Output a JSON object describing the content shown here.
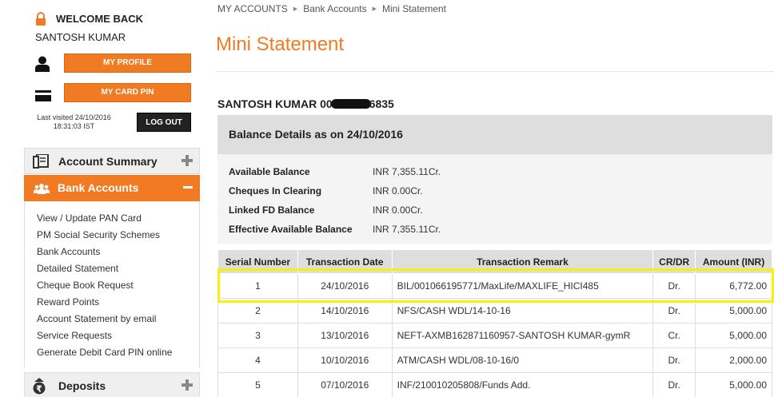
{
  "sidebar": {
    "welcome_title": "WELCOME BACK",
    "user_name": "SANTOSH KUMAR",
    "my_profile_label": "MY PROFILE",
    "my_card_pin_label": "MY CARD PIN",
    "last_visited_line1": "Last visited 24/10/2016",
    "last_visited_line2": "18:31:03 IST",
    "logout_label": "LOG OUT",
    "account_summary_label": "Account Summary",
    "bank_accounts_label": "Bank Accounts",
    "bank_accounts_items": [
      "View / Update PAN Card",
      "PM Social Security Schemes",
      "Bank Accounts",
      "Detailed Statement",
      "Cheque Book Request",
      "Reward Points",
      "Account Statement by email",
      "Service Requests",
      "Generate Debit Card PIN online"
    ],
    "deposits_label": "Deposits",
    "accent_color": "#f07b23"
  },
  "breadcrumb": [
    "MY ACCOUNTS",
    "Bank Accounts",
    "Mini Statement"
  ],
  "page_title": "Mini Statement",
  "account": {
    "name_prefix": "SANTOSH KUMAR 00",
    "name_suffix": "6835"
  },
  "balance": {
    "header": "Balance Details as on 24/10/2016",
    "rows": [
      {
        "label": "Available Balance",
        "value": "INR 7,355.11Cr."
      },
      {
        "label": "Cheques In Clearing",
        "value": "INR 0.00Cr."
      },
      {
        "label": "Linked FD Balance",
        "value": "INR 0.00Cr."
      },
      {
        "label": "Effective Available Balance",
        "value": "INR 7,355.11Cr."
      }
    ]
  },
  "transactions": {
    "headers": [
      "Serial Number",
      "Transaction Date",
      "Transaction Remark",
      "CR/DR",
      "Amount (INR)"
    ],
    "rows": [
      {
        "serial": "1",
        "date": "24/10/2016",
        "remark": "BIL/001066195771/MaxLife/MAXLIFE_HICI485",
        "crdr": "Dr.",
        "amount": "6,772.00"
      },
      {
        "serial": "2",
        "date": "14/10/2016",
        "remark": "NFS/CASH WDL/14-10-16",
        "crdr": "Dr.",
        "amount": "5,000.00"
      },
      {
        "serial": "3",
        "date": "13/10/2016",
        "remark": "NEFT-AXMB162871160957-SANTOSH KUMAR-gymR",
        "crdr": "Cr.",
        "amount": "5,000.00"
      },
      {
        "serial": "4",
        "date": "10/10/2016",
        "remark": "ATM/CASH WDL/08-10-16/0",
        "crdr": "Dr.",
        "amount": "2,000.00"
      },
      {
        "serial": "5",
        "date": "07/10/2016",
        "remark": "INF/210010205808/Funds Add.",
        "crdr": "Dr.",
        "amount": "5,000.00"
      }
    ]
  }
}
